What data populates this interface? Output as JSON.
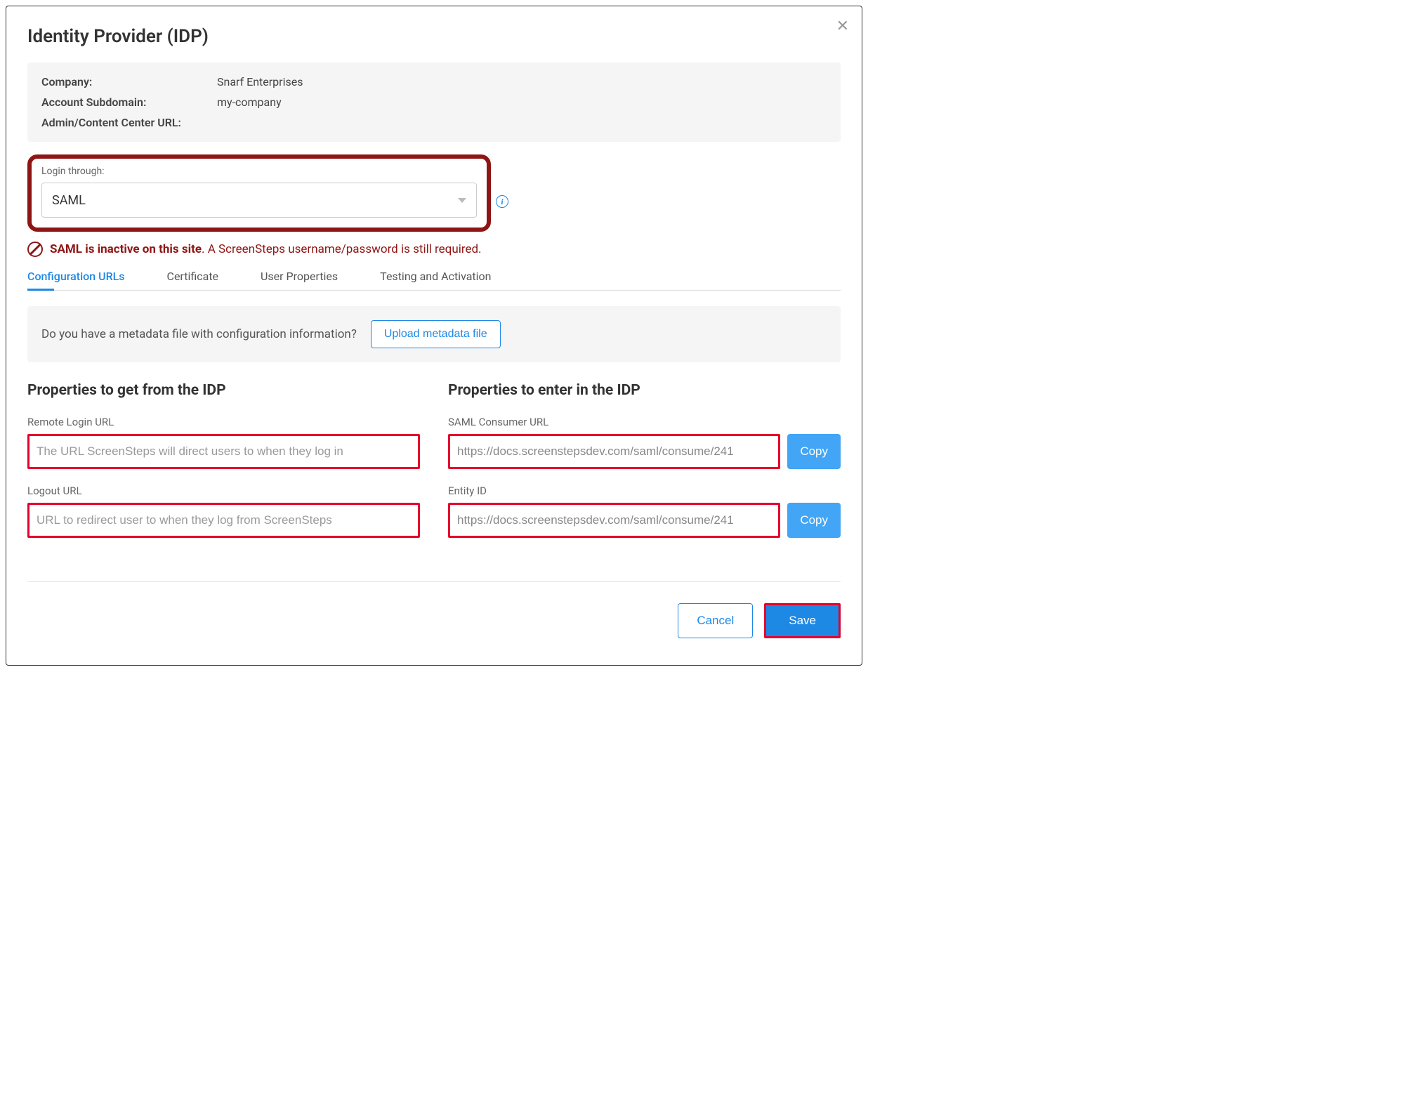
{
  "header": {
    "title": "Identity Provider (IDP)"
  },
  "info": {
    "company_label": "Company:",
    "company_value": "Snarf Enterprises",
    "subdomain_label": "Account Subdomain:",
    "subdomain_value": "my-company",
    "adminurl_label": "Admin/Content Center URL:",
    "adminurl_value": ""
  },
  "login": {
    "label": "Login through:",
    "selected": "SAML"
  },
  "alert": {
    "strong": "SAML is inactive on this site",
    "rest": ". A ScreenSteps username/password is still required."
  },
  "tabs": [
    {
      "label": "Configuration URLs"
    },
    {
      "label": "Certificate"
    },
    {
      "label": "User Properties"
    },
    {
      "label": "Testing and Activation"
    }
  ],
  "metadata": {
    "question": "Do you have a metadata file with configuration information?",
    "button": "Upload metadata file"
  },
  "left": {
    "heading": "Properties to get from the IDP",
    "remote_login_label": "Remote Login URL",
    "remote_login_placeholder": "The URL ScreenSteps will direct users to when they log in",
    "logout_label": "Logout URL",
    "logout_placeholder": "URL to redirect user to when they log from ScreenSteps"
  },
  "right": {
    "heading": "Properties to enter in the IDP",
    "consumer_label": "SAML Consumer URL",
    "consumer_value": "https://docs.screenstepsdev.com/saml/consume/241",
    "entity_label": "Entity ID",
    "entity_value": "https://docs.screenstepsdev.com/saml/consume/241",
    "copy_label": "Copy"
  },
  "footer": {
    "cancel": "Cancel",
    "save": "Save"
  }
}
